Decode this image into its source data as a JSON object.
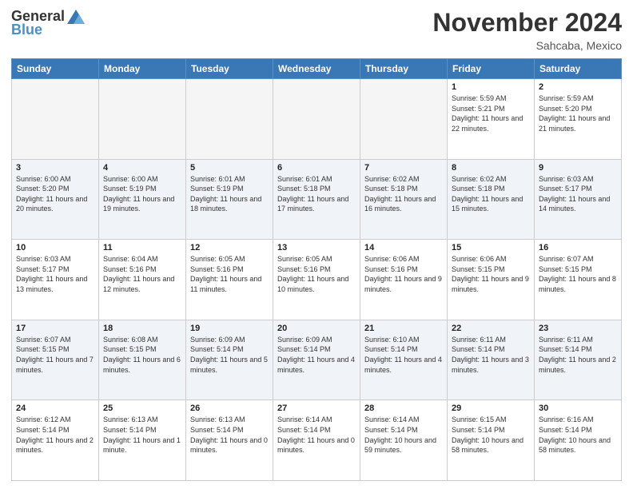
{
  "logo": {
    "general": "General",
    "blue": "Blue"
  },
  "title": "November 2024",
  "location": "Sahcaba, Mexico",
  "days_header": [
    "Sunday",
    "Monday",
    "Tuesday",
    "Wednesday",
    "Thursday",
    "Friday",
    "Saturday"
  ],
  "weeks": [
    [
      {
        "day": "",
        "info": ""
      },
      {
        "day": "",
        "info": ""
      },
      {
        "day": "",
        "info": ""
      },
      {
        "day": "",
        "info": ""
      },
      {
        "day": "",
        "info": ""
      },
      {
        "day": "1",
        "info": "Sunrise: 5:59 AM\nSunset: 5:21 PM\nDaylight: 11 hours and 22 minutes."
      },
      {
        "day": "2",
        "info": "Sunrise: 5:59 AM\nSunset: 5:20 PM\nDaylight: 11 hours and 21 minutes."
      }
    ],
    [
      {
        "day": "3",
        "info": "Sunrise: 6:00 AM\nSunset: 5:20 PM\nDaylight: 11 hours and 20 minutes."
      },
      {
        "day": "4",
        "info": "Sunrise: 6:00 AM\nSunset: 5:19 PM\nDaylight: 11 hours and 19 minutes."
      },
      {
        "day": "5",
        "info": "Sunrise: 6:01 AM\nSunset: 5:19 PM\nDaylight: 11 hours and 18 minutes."
      },
      {
        "day": "6",
        "info": "Sunrise: 6:01 AM\nSunset: 5:18 PM\nDaylight: 11 hours and 17 minutes."
      },
      {
        "day": "7",
        "info": "Sunrise: 6:02 AM\nSunset: 5:18 PM\nDaylight: 11 hours and 16 minutes."
      },
      {
        "day": "8",
        "info": "Sunrise: 6:02 AM\nSunset: 5:18 PM\nDaylight: 11 hours and 15 minutes."
      },
      {
        "day": "9",
        "info": "Sunrise: 6:03 AM\nSunset: 5:17 PM\nDaylight: 11 hours and 14 minutes."
      }
    ],
    [
      {
        "day": "10",
        "info": "Sunrise: 6:03 AM\nSunset: 5:17 PM\nDaylight: 11 hours and 13 minutes."
      },
      {
        "day": "11",
        "info": "Sunrise: 6:04 AM\nSunset: 5:16 PM\nDaylight: 11 hours and 12 minutes."
      },
      {
        "day": "12",
        "info": "Sunrise: 6:05 AM\nSunset: 5:16 PM\nDaylight: 11 hours and 11 minutes."
      },
      {
        "day": "13",
        "info": "Sunrise: 6:05 AM\nSunset: 5:16 PM\nDaylight: 11 hours and 10 minutes."
      },
      {
        "day": "14",
        "info": "Sunrise: 6:06 AM\nSunset: 5:16 PM\nDaylight: 11 hours and 9 minutes."
      },
      {
        "day": "15",
        "info": "Sunrise: 6:06 AM\nSunset: 5:15 PM\nDaylight: 11 hours and 9 minutes."
      },
      {
        "day": "16",
        "info": "Sunrise: 6:07 AM\nSunset: 5:15 PM\nDaylight: 11 hours and 8 minutes."
      }
    ],
    [
      {
        "day": "17",
        "info": "Sunrise: 6:07 AM\nSunset: 5:15 PM\nDaylight: 11 hours and 7 minutes."
      },
      {
        "day": "18",
        "info": "Sunrise: 6:08 AM\nSunset: 5:15 PM\nDaylight: 11 hours and 6 minutes."
      },
      {
        "day": "19",
        "info": "Sunrise: 6:09 AM\nSunset: 5:14 PM\nDaylight: 11 hours and 5 minutes."
      },
      {
        "day": "20",
        "info": "Sunrise: 6:09 AM\nSunset: 5:14 PM\nDaylight: 11 hours and 4 minutes."
      },
      {
        "day": "21",
        "info": "Sunrise: 6:10 AM\nSunset: 5:14 PM\nDaylight: 11 hours and 4 minutes."
      },
      {
        "day": "22",
        "info": "Sunrise: 6:11 AM\nSunset: 5:14 PM\nDaylight: 11 hours and 3 minutes."
      },
      {
        "day": "23",
        "info": "Sunrise: 6:11 AM\nSunset: 5:14 PM\nDaylight: 11 hours and 2 minutes."
      }
    ],
    [
      {
        "day": "24",
        "info": "Sunrise: 6:12 AM\nSunset: 5:14 PM\nDaylight: 11 hours and 2 minutes."
      },
      {
        "day": "25",
        "info": "Sunrise: 6:13 AM\nSunset: 5:14 PM\nDaylight: 11 hours and 1 minute."
      },
      {
        "day": "26",
        "info": "Sunrise: 6:13 AM\nSunset: 5:14 PM\nDaylight: 11 hours and 0 minutes."
      },
      {
        "day": "27",
        "info": "Sunrise: 6:14 AM\nSunset: 5:14 PM\nDaylight: 11 hours and 0 minutes."
      },
      {
        "day": "28",
        "info": "Sunrise: 6:14 AM\nSunset: 5:14 PM\nDaylight: 10 hours and 59 minutes."
      },
      {
        "day": "29",
        "info": "Sunrise: 6:15 AM\nSunset: 5:14 PM\nDaylight: 10 hours and 58 minutes."
      },
      {
        "day": "30",
        "info": "Sunrise: 6:16 AM\nSunset: 5:14 PM\nDaylight: 10 hours and 58 minutes."
      }
    ]
  ]
}
